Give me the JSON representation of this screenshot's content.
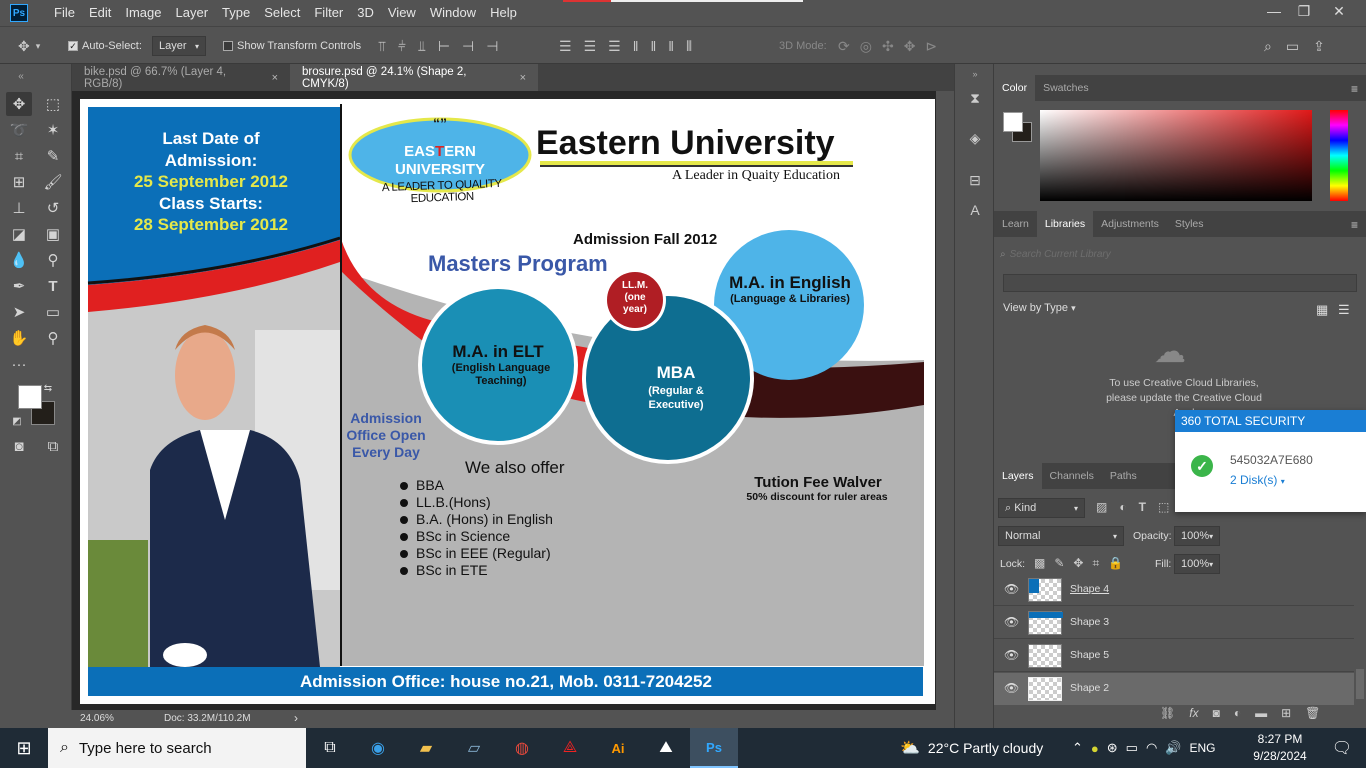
{
  "menu": {
    "logo": "Ps",
    "items": [
      "File",
      "Edit",
      "Image",
      "Layer",
      "Type",
      "Select",
      "Filter",
      "3D",
      "View",
      "Window",
      "Help"
    ]
  },
  "options": {
    "auto_select_label": "Auto-Select:",
    "auto_select_value": "Layer",
    "transform_label": "Show Transform Controls",
    "mode_3d_label": "3D Mode:"
  },
  "tabs": [
    {
      "label": "bike.psd @ 66.7% (Layer 4, RGB/8)",
      "close": "×"
    },
    {
      "label": "brosure.psd @ 24.1% (Shape 2, CMYK/8)",
      "close": "×"
    }
  ],
  "status": {
    "zoom": "24.06%",
    "doc": "Doc: 33.2M/110.2M",
    "arrow": "›"
  },
  "brochure": {
    "left_box": [
      "Last Date of",
      "Admission:",
      "25 September 2012",
      "Class Starts:",
      "28 September 2012"
    ],
    "logo_quote": "“”",
    "logo_line1_a": "EAS",
    "logo_line1_b": "T",
    "logo_line1_c": "ERN",
    "logo_line2": "UNIVERSITY",
    "logo_tagline": "A LEADER TO QUALITY EDUCATION",
    "title": "Eastern University",
    "subtitle": "A Leader in Quaity Education",
    "admission_fall": "Admission Fall 2012",
    "masters": "Masters Program",
    "circle_elt_title": "M.A. in ELT",
    "circle_elt_sub": "(English Language Teaching)",
    "circle_llm": "LL.M. (one year)",
    "circle_mba_title": "MBA",
    "circle_mba_sub": "(Regular & Executive)",
    "circle_eng_title": "M.A. in English",
    "circle_eng_sub": "(Language & Libraries)",
    "office_open": [
      "Admission",
      "Office Open",
      "Every Day"
    ],
    "also_offer": "We also offer",
    "programs": [
      "BBA",
      "LL.B.(Hons)",
      "B.A. (Hons) in English",
      "BSc in Science",
      "BSc in EEE (Regular)",
      "BSc in ETE"
    ],
    "fee_title": "Tution Fee Walver",
    "fee_sub": "50% discount for ruler areas",
    "footer": "Admission Office: house no.21, Mob. 0311-7204252"
  },
  "color_panel": {
    "tabs": [
      "Color",
      "Swatches"
    ]
  },
  "libraries_panel": {
    "tabs": [
      "Learn",
      "Libraries",
      "Adjustments",
      "Styles"
    ],
    "search_placeholder": "Search Current Library",
    "view_by": "View by Type",
    "message": [
      "To use Creative Cloud Libraries,",
      "please update the Creative Cloud",
      "Appl"
    ]
  },
  "security_popup": {
    "title": "360 TOTAL SECURITY",
    "code": "545032A7E680",
    "disks": "2 Disk(s)"
  },
  "layers_panel": {
    "tabs": [
      "Layers",
      "Channels",
      "Paths"
    ],
    "kind": "Kind",
    "blend_mode": "Normal",
    "opacity_label": "Opacity:",
    "opacity_value": "100%",
    "lock_label": "Lock:",
    "fill_label": "Fill:",
    "fill_value": "100%",
    "layers": [
      "Shape 4",
      "Shape 3",
      "Shape 5",
      "Shape 2"
    ]
  },
  "taskbar": {
    "search_placeholder": "Type here to search",
    "weather": "22°C  Partly cloudy",
    "language": "ENG",
    "time": "8:27 PM",
    "date": "9/28/2024"
  },
  "colors": {
    "ps_bg": "#535353",
    "brochure_blue": "#0b6fb8",
    "brochure_yellow": "#e5e84a",
    "circle_teal": "#1a8fb5",
    "circle_dark": "#0e6e91",
    "circle_light": "#4eb4e8",
    "llm_red": "#b01e24",
    "ribbon_red": "#e02020"
  }
}
